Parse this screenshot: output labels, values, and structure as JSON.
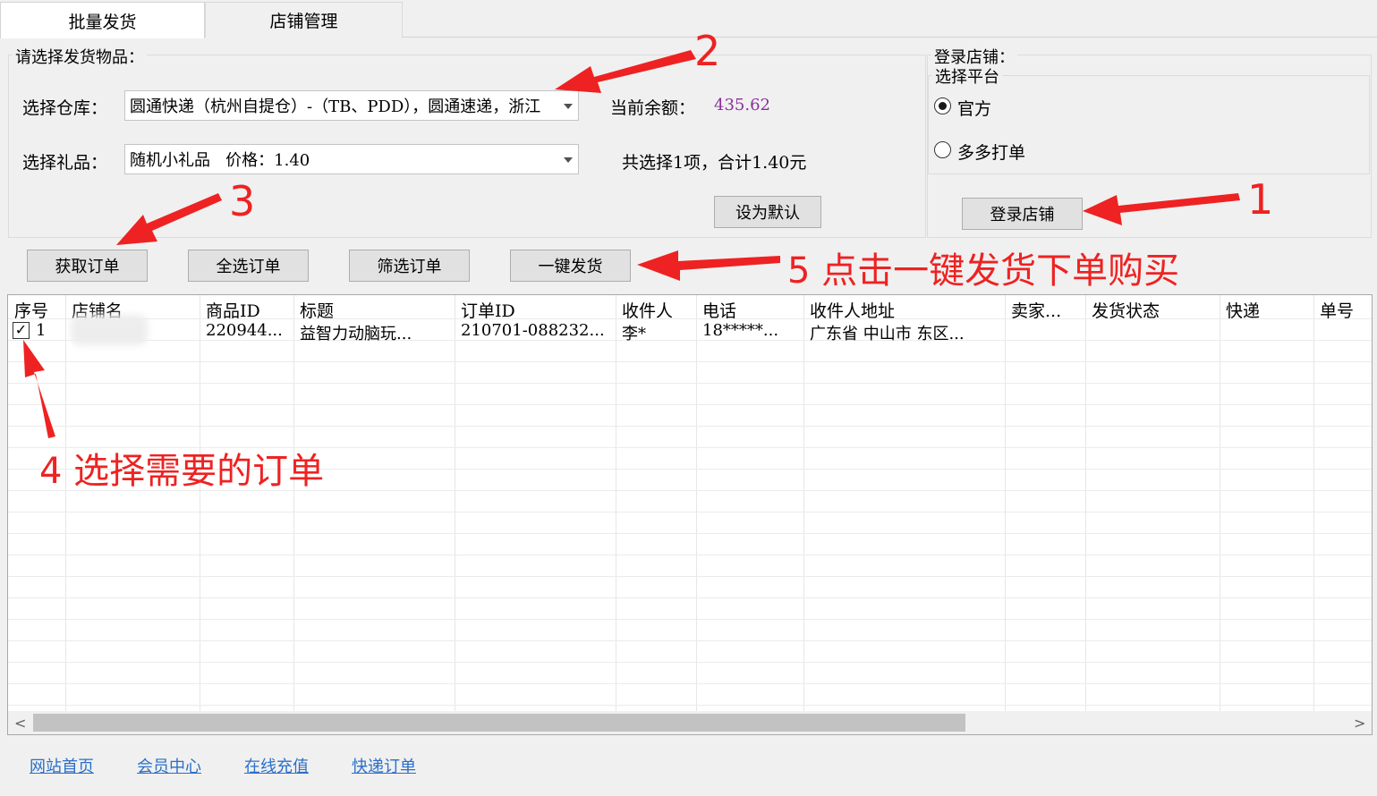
{
  "tabs": [
    {
      "label": "批量发货",
      "active": true
    },
    {
      "label": "店铺管理",
      "active": false
    }
  ],
  "goods_group": {
    "title": "请选择发货物品：",
    "warehouse_label": "选择仓库：",
    "warehouse_value": "圆通快递（杭州自提仓）-（TB、PDD），圆通速递，浙江",
    "balance_label": "当前余额：",
    "balance_value": "435.62",
    "gift_label": "选择礼品：",
    "gift_value": "随机小礼品   价格：1.40",
    "summary": "共选择1项，合计1.40元",
    "set_default_label": "设为默认"
  },
  "login_group": {
    "title": "登录店铺：",
    "platform_title": "选择平台",
    "options": [
      {
        "label": "官方",
        "checked": true
      },
      {
        "label": "多多打单",
        "checked": false
      }
    ],
    "login_button": "登录店铺"
  },
  "toolbar": {
    "fetch_orders": "获取订单",
    "select_all": "全选订单",
    "filter_orders": "筛选订单",
    "one_click_ship": "一键发货"
  },
  "table": {
    "columns": [
      "序号",
      "店铺名",
      "商品ID",
      "标题",
      "订单ID",
      "收件人",
      "电话",
      "收件人地址",
      "卖家...",
      "发货状态",
      "快递",
      "单号"
    ],
    "rows": [
      {
        "checked": true,
        "index": "1",
        "shop": "",
        "product_id": "220944...",
        "title": "益智力动脑玩...",
        "order_id": "210701-088232...",
        "recipient": "李*",
        "phone": "18*****...",
        "address": "广东省 中山市 东区...",
        "seller": "",
        "status": "",
        "express": "",
        "tracking": ""
      }
    ]
  },
  "footer_links": [
    "网站首页",
    "会员中心",
    "在线充值",
    "快递订单"
  ],
  "annotations": {
    "step1": "1",
    "step2": "2",
    "step3": "3",
    "step4": "4 选择需要的订单",
    "step5": "5 点击一键发货下单购买"
  },
  "colors": {
    "annotation": "#ee2222",
    "balance": "#8b2f9b",
    "link": "#2a6fc9"
  }
}
